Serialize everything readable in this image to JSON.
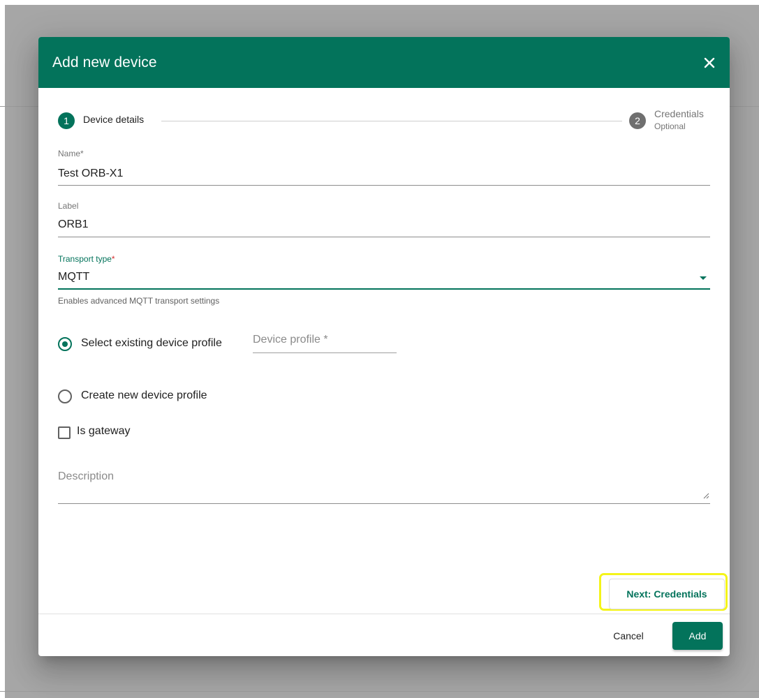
{
  "dialog": {
    "title": "Add new device",
    "close_icon": "close-icon"
  },
  "stepper": {
    "step1": {
      "number": "1",
      "label": "Device details"
    },
    "step2": {
      "number": "2",
      "label": "Credentials",
      "sublabel": "Optional"
    }
  },
  "form": {
    "name": {
      "label": "Name",
      "required_mark": "*",
      "value": "Test ORB-X1"
    },
    "label_field": {
      "label": "Label",
      "value": "ORB1"
    },
    "transport": {
      "label": "Transport type",
      "required_mark": "*",
      "value": "MQTT",
      "hint": "Enables advanced MQTT transport settings",
      "dropdown_icon": "caret-down-icon"
    },
    "profile_options": {
      "existing": "Select existing device profile",
      "new": "Create new device profile",
      "selected": "existing"
    },
    "device_profile_placeholder": "Device profile *",
    "is_gateway": {
      "label": "Is gateway",
      "checked": false
    },
    "description_placeholder": "Description"
  },
  "actions": {
    "next": "Next: Credentials",
    "cancel": "Cancel",
    "add": "Add"
  },
  "colors": {
    "primary": "#03735b",
    "highlight": "#f4f41a",
    "required": "#d32f2f"
  }
}
